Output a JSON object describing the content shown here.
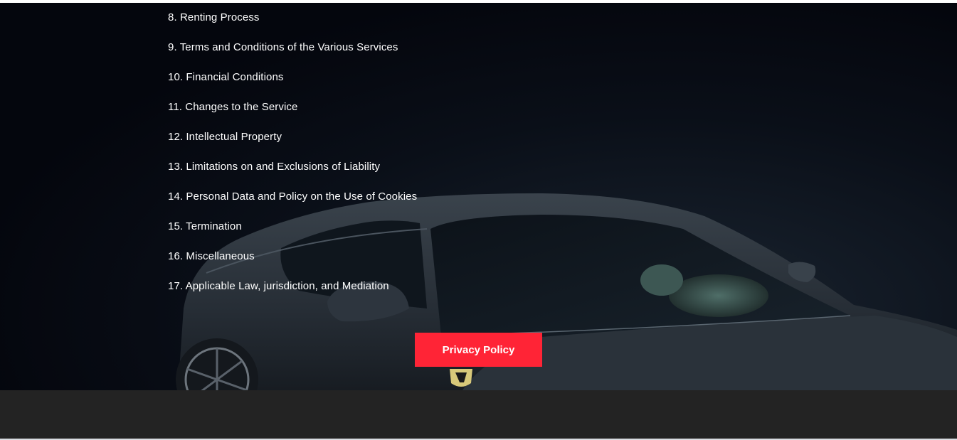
{
  "terms": {
    "items": [
      "8. Renting Process",
      "9. Terms and Conditions of the Various Services",
      "10. Financial Conditions",
      "11. Changes to the Service",
      "12. Intellectual Property",
      "13. Limitations on and Exclusions of Liability",
      "14. Personal Data and Policy on the Use of Cookies",
      "15. Termination",
      "16. Miscellaneous",
      "17. Applicable Law, jurisdiction, and Mediation"
    ]
  },
  "actions": {
    "privacy_label": "Privacy Policy"
  },
  "colors": {
    "hero_background": "#04060d",
    "button_accent": "#ff2436",
    "footer_background": "#232323",
    "text": "#ffffff"
  },
  "icons": {
    "hero": "sports-car-image"
  }
}
